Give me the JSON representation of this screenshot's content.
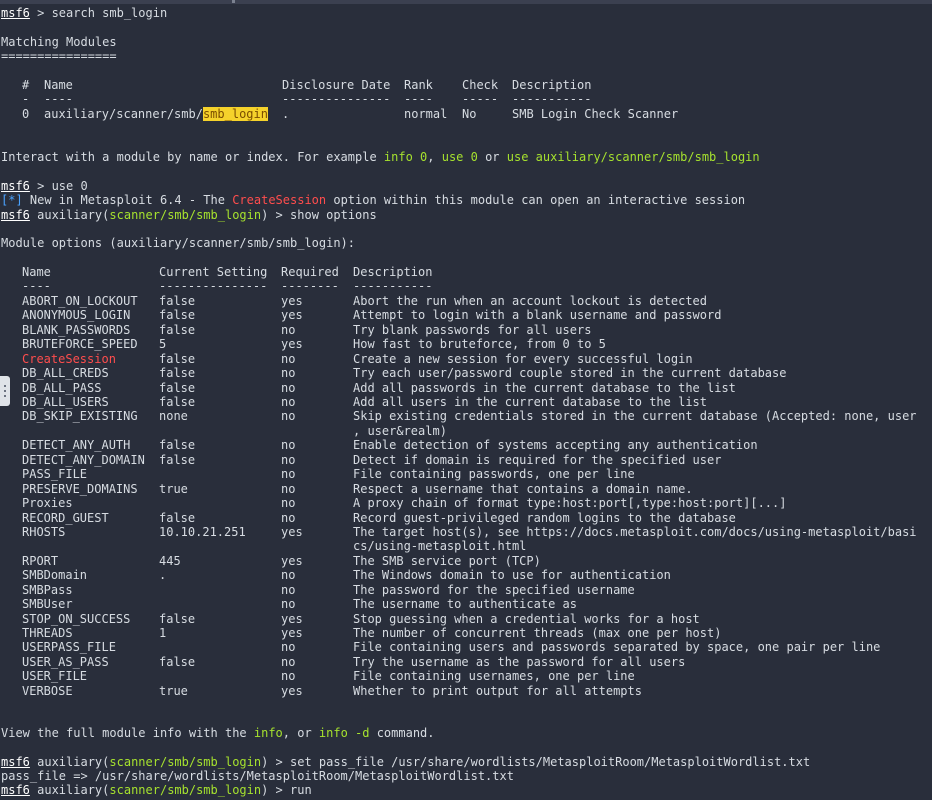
{
  "terminal": {
    "prompt_name": "msf6",
    "prompt_module": "scanner/smb/smb_login",
    "cmd_search": " > search smb_login",
    "matching_title": "Matching Modules",
    "matching_underline": "================",
    "search_headers": {
      "num": "#",
      "name": "Name",
      "date": "Disclosure Date",
      "rank": "Rank",
      "check": "Check",
      "desc": "Description"
    },
    "search_dashes": {
      "num": "-",
      "name": "----",
      "date": "---------------",
      "rank": "----",
      "check": "-----",
      "desc": "-----------"
    },
    "search_result": {
      "num": "0",
      "name_prefix": "auxiliary/scanner/smb/",
      "name_match": "smb_login",
      "date": ".",
      "rank": "normal",
      "check": "No",
      "desc": "SMB Login Check Scanner"
    },
    "interact": {
      "prefix": "Interact with a module by name or index. For example ",
      "info": "info 0",
      "sep1": ", ",
      "use": "use 0",
      "sep2": " or ",
      "use_full": "use auxiliary/scanner/smb/smb_login"
    },
    "cmd_use": " > use 0",
    "notice_tag": "[*]",
    "notice_text": " New in Metasploit 6.4 - The ",
    "notice_option": "CreateSession",
    "notice_rest": " option within this module can open an interactive session",
    "prompt_aux_open": " auxiliary(",
    "prompt_aux_close": ") > ",
    "cmd_show": "show options",
    "options_title": "Module options (auxiliary/scanner/smb/smb_login):",
    "options_headers": {
      "name": "Name",
      "setting": "Current Setting",
      "required": "Required",
      "desc": "Description"
    },
    "options_dashes": {
      "name": "----",
      "setting": "---------------",
      "required": "--------",
      "desc": "-----------"
    },
    "options": [
      {
        "name": "ABORT_ON_LOCKOUT",
        "setting": "false",
        "required": "yes",
        "desc": "Abort the run when an account lockout is detected"
      },
      {
        "name": "ANONYMOUS_LOGIN",
        "setting": "false",
        "required": "yes",
        "desc": "Attempt to login with a blank username and password"
      },
      {
        "name": "BLANK_PASSWORDS",
        "setting": "false",
        "required": "no",
        "desc": "Try blank passwords for all users"
      },
      {
        "name": "BRUTEFORCE_SPEED",
        "setting": "5",
        "required": "yes",
        "desc": "How fast to bruteforce, from 0 to 5"
      },
      {
        "name": "CreateSession",
        "setting": "false",
        "required": "no",
        "desc": "Create a new session for every successful login"
      },
      {
        "name": "DB_ALL_CREDS",
        "setting": "false",
        "required": "no",
        "desc": "Try each user/password couple stored in the current database"
      },
      {
        "name": "DB_ALL_PASS",
        "setting": "false",
        "required": "no",
        "desc": "Add all passwords in the current database to the list"
      },
      {
        "name": "DB_ALL_USERS",
        "setting": "false",
        "required": "no",
        "desc": "Add all users in the current database to the list"
      },
      {
        "name": "DB_SKIP_EXISTING",
        "setting": "none",
        "required": "no",
        "desc": "Skip existing credentials stored in the current database (Accepted: none, user",
        "desc2": ", user&realm)"
      },
      {
        "name": "DETECT_ANY_AUTH",
        "setting": "false",
        "required": "no",
        "desc": "Enable detection of systems accepting any authentication"
      },
      {
        "name": "DETECT_ANY_DOMAIN",
        "setting": "false",
        "required": "no",
        "desc": "Detect if domain is required for the specified user"
      },
      {
        "name": "PASS_FILE",
        "setting": "",
        "required": "no",
        "desc": "File containing passwords, one per line"
      },
      {
        "name": "PRESERVE_DOMAINS",
        "setting": "true",
        "required": "no",
        "desc": "Respect a username that contains a domain name."
      },
      {
        "name": "Proxies",
        "setting": "",
        "required": "no",
        "desc": "A proxy chain of format type:host:port[,type:host:port][...]"
      },
      {
        "name": "RECORD_GUEST",
        "setting": "false",
        "required": "no",
        "desc": "Record guest-privileged random logins to the database"
      },
      {
        "name": "RHOSTS",
        "setting": "10.10.21.251",
        "required": "yes",
        "desc": "The target host(s), see https://docs.metasploit.com/docs/using-metasploit/basi",
        "desc2": "cs/using-metasploit.html"
      },
      {
        "name": "RPORT",
        "setting": "445",
        "required": "yes",
        "desc": "The SMB service port (TCP)"
      },
      {
        "name": "SMBDomain",
        "setting": ".",
        "required": "no",
        "desc": "The Windows domain to use for authentication"
      },
      {
        "name": "SMBPass",
        "setting": "",
        "required": "no",
        "desc": "The password for the specified username"
      },
      {
        "name": "SMBUser",
        "setting": "",
        "required": "no",
        "desc": "The username to authenticate as"
      },
      {
        "name": "STOP_ON_SUCCESS",
        "setting": "false",
        "required": "yes",
        "desc": "Stop guessing when a credential works for a host"
      },
      {
        "name": "THREADS",
        "setting": "1",
        "required": "yes",
        "desc": "The number of concurrent threads (max one per host)"
      },
      {
        "name": "USERPASS_FILE",
        "setting": "",
        "required": "no",
        "desc": "File containing users and passwords separated by space, one pair per line"
      },
      {
        "name": "USER_AS_PASS",
        "setting": "false",
        "required": "no",
        "desc": "Try the username as the password for all users"
      },
      {
        "name": "USER_FILE",
        "setting": "",
        "required": "no",
        "desc": "File containing usernames, one per line"
      },
      {
        "name": "VERBOSE",
        "setting": "true",
        "required": "yes",
        "desc": "Whether to print output for all attempts"
      }
    ],
    "view": {
      "prefix": "View the full module info with the ",
      "info": "info",
      "mid": ", or ",
      "info_d": "info -d",
      "suffix": " command."
    },
    "cmd_set": "set pass_file /usr/share/wordlists/MetasploitRoom/MetasploitWordlist.txt",
    "set_result": "pass_file => /usr/share/wordlists/MetasploitRoom/MetasploitWordlist.txt",
    "cmd_run": "run"
  },
  "colors": {
    "background": "#292e3b",
    "module": "#a6e22e",
    "notice": "#4aa3ff",
    "option_highlight": "#ff4d4d",
    "search_highlight": "#f5d22b"
  },
  "icons": {
    "side_handle": "drag-handle-icon"
  }
}
